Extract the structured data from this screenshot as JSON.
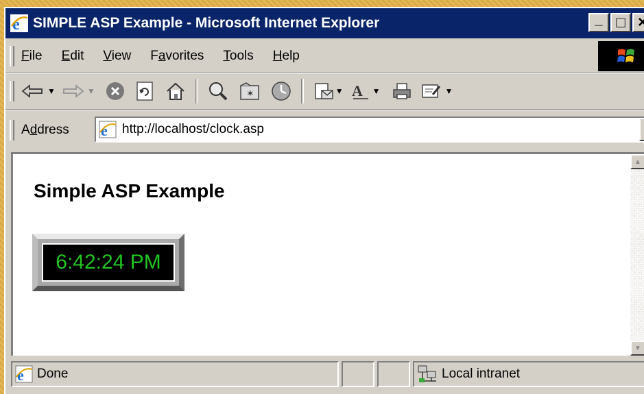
{
  "window": {
    "title": "SIMPLE ASP Example - Microsoft Internet Explorer",
    "controls": {
      "minimize": "_",
      "maximize": "□",
      "close": "×"
    }
  },
  "menu": {
    "items": [
      {
        "label": "File",
        "accel": "F",
        "rest": "ile"
      },
      {
        "label": "Edit",
        "accel": "E",
        "rest": "dit"
      },
      {
        "label": "View",
        "accel": "V",
        "rest": "iew"
      },
      {
        "label": "Favorites",
        "pre": "F",
        "accel": "a",
        "rest": "vorites"
      },
      {
        "label": "Tools",
        "accel": "T",
        "rest": "ools"
      },
      {
        "label": "Help",
        "accel": "H",
        "rest": "elp"
      }
    ]
  },
  "toolbar": {
    "icons": [
      "back-icon",
      "forward-icon",
      "stop-icon",
      "refresh-icon",
      "home-icon",
      "search-icon",
      "favorites-icon",
      "history-icon",
      "mail-icon",
      "font-size-icon",
      "print-icon",
      "edit-icon"
    ]
  },
  "address": {
    "label_pre": "A",
    "label_accel": "d",
    "label_rest": "dress",
    "url": "http://localhost/clock.asp"
  },
  "page": {
    "heading": "Simple ASP Example",
    "clock_time": "6:42:24 PM"
  },
  "status": {
    "text": "Done",
    "zone": "Local intranet"
  },
  "colors": {
    "titlebar": "#0a246a",
    "clock_digits": "#22c522",
    "desktop": "#e2b24a",
    "chrome": "#d4d0c8"
  }
}
